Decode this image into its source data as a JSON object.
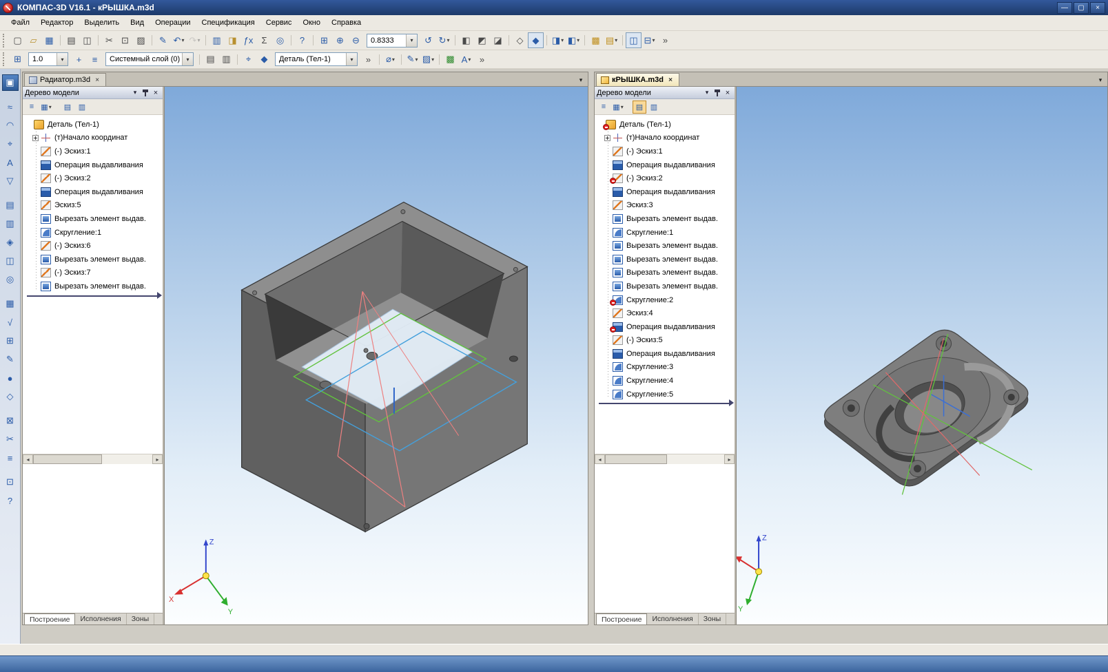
{
  "window": {
    "title": "КОМПАС-3D V16.1 - кРЫШКА.m3d",
    "controls": [
      {
        "name": "minimize-button",
        "glyph": "—"
      },
      {
        "name": "maximize-button",
        "glyph": "▢"
      },
      {
        "name": "close-button",
        "glyph": "×"
      }
    ]
  },
  "menu": {
    "items": [
      "Файл",
      "Редактор",
      "Выделить",
      "Вид",
      "Операции",
      "Спецификация",
      "Сервис",
      "Окно",
      "Справка"
    ]
  },
  "toolbar_main": {
    "zoom_value": "0.8333",
    "buttons_before_zoom": [
      {
        "name": "new-document-button",
        "glyph": "▢",
        "color": "#4a4a4a"
      },
      {
        "name": "open-document-button",
        "glyph": "▱",
        "color": "#b8902f"
      },
      {
        "name": "save-button",
        "glyph": "▦",
        "color": "#2b5ca8"
      },
      {
        "name": "print-button",
        "glyph": "▤",
        "color": "#4a4a4a",
        "grp": true
      },
      {
        "name": "print-preview-button",
        "glyph": "◫",
        "color": "#4a4a4a"
      },
      {
        "name": "cut-button",
        "glyph": "✂",
        "color": "#4a4a4a",
        "grp": true
      },
      {
        "name": "copy-button",
        "glyph": "⊡",
        "color": "#4a4a4a"
      },
      {
        "name": "paste-button",
        "glyph": "▨",
        "color": "#4a4a4a"
      },
      {
        "name": "copy-properties-button",
        "glyph": "✎",
        "color": "#2b5ca8",
        "grp": true
      },
      {
        "name": "undo-button",
        "glyph": "↶",
        "color": "#2b5ca8",
        "dd": true
      },
      {
        "name": "redo-button",
        "glyph": "↷",
        "color": "#9a9a9a",
        "dd": true,
        "dis": true
      },
      {
        "name": "library-manager-button",
        "glyph": "▥",
        "color": "#2b5ca8",
        "grp": true
      },
      {
        "name": "typical-models-button",
        "glyph": "◨",
        "color": "#b8902f"
      },
      {
        "name": "functions-button",
        "glyph": "ƒx",
        "color": "#2b5ca8"
      },
      {
        "name": "variables-button",
        "glyph": "Σ",
        "color": "#4a4a4a"
      },
      {
        "name": "find-button",
        "glyph": "◎",
        "color": "#2b5ca8"
      },
      {
        "name": "context-help-button",
        "glyph": "?",
        "color": "#2b5ca8",
        "grp": true
      },
      {
        "name": "zoom-window-button",
        "glyph": "⊞",
        "color": "#2b5ca8",
        "grp": true
      },
      {
        "name": "zoom-in-button",
        "glyph": "⊕",
        "color": "#2b5ca8"
      },
      {
        "name": "zoom-out-button",
        "glyph": "⊖",
        "color": "#2b5ca8"
      }
    ],
    "buttons_after_zoom": [
      {
        "name": "refresh-view-button",
        "glyph": "↺",
        "color": "#2b5ca8"
      },
      {
        "name": "rotate-view-button",
        "glyph": "↻",
        "color": "#2b5ca8",
        "dd": true
      },
      {
        "name": "orientation-front-button",
        "glyph": "◧",
        "color": "#4a4a4a",
        "grp": true
      },
      {
        "name": "orientation-iso-button",
        "glyph": "◩",
        "color": "#4a4a4a"
      },
      {
        "name": "orientation-top-button",
        "glyph": "◪",
        "color": "#4a4a4a"
      },
      {
        "name": "display-wireframe-button",
        "glyph": "◇",
        "color": "#4a4a4a",
        "grp": true
      },
      {
        "name": "display-shaded-button",
        "glyph": "◆",
        "color": "#2b5ca8",
        "on": true
      },
      {
        "name": "hide-faces-button",
        "glyph": "◨",
        "color": "#2b5ca8",
        "dd": true,
        "grp": true
      },
      {
        "name": "hide-objects-button",
        "glyph": "◧",
        "color": "#2b5ca8",
        "dd": true
      },
      {
        "name": "section-view-button",
        "glyph": "▩",
        "color": "#c09020",
        "grp": true
      },
      {
        "name": "clip-surface-button",
        "glyph": "▤",
        "color": "#c09020",
        "dd": true
      },
      {
        "name": "sketch-mode-button",
        "glyph": "◫",
        "color": "#2b5ca8",
        "on": true,
        "grp": true
      },
      {
        "name": "mass-properties-button",
        "glyph": "⊟",
        "color": "#2b5ca8",
        "dd": true
      },
      {
        "name": "toolbar-options-button",
        "glyph": "»",
        "color": "#4a4a4a"
      }
    ]
  },
  "toolbar_params": {
    "scale_value": "1.0",
    "layer_value": "Системный слой (0)",
    "part_value": "Деталь (Тел-1)",
    "buttons_a": [
      {
        "name": "grid-button",
        "glyph": "⊞",
        "color": "#2b5ca8"
      }
    ],
    "buttons_b": [
      {
        "name": "snap-button",
        "glyph": "+",
        "color": "#2b5ca8"
      },
      {
        "name": "layers-button",
        "glyph": "≡",
        "color": "#2b5ca8"
      }
    ],
    "buttons_c": [
      {
        "name": "sheet-settings-button",
        "glyph": "▤",
        "color": "#4a4a4a",
        "grp": true
      },
      {
        "name": "sheet-add-button",
        "glyph": "▥",
        "color": "#4a4a4a"
      },
      {
        "name": "local-cs-button",
        "glyph": "⌖",
        "color": "#2b5ca8",
        "grp": true
      },
      {
        "name": "current-model-button",
        "glyph": "◆",
        "color": "#2b5ca8"
      }
    ],
    "buttons_d": [
      {
        "name": "params-overflow-button",
        "glyph": "»",
        "color": "#4a4a4a"
      },
      {
        "name": "rounding-button",
        "glyph": "⌀",
        "color": "#2b5ca8",
        "dd": true,
        "grp": true
      },
      {
        "name": "line-style-button",
        "glyph": "✎",
        "color": "#2b5ca8",
        "dd": true,
        "grp": true
      },
      {
        "name": "hatch-button",
        "glyph": "▨",
        "color": "#2b5ca8",
        "dd": true
      },
      {
        "name": "new-body-button",
        "glyph": "▩",
        "color": "#2e8b2e",
        "grp": true
      },
      {
        "name": "dimensions-style-button",
        "glyph": "A",
        "color": "#2b5ca8",
        "dd": true
      },
      {
        "name": "params-more-button",
        "glyph": "»",
        "color": "#4a4a4a"
      }
    ]
  },
  "left_rail": {
    "buttons": [
      {
        "name": "component-panel-button",
        "glyph": "▣",
        "on": true
      },
      {
        "name": "spatial-curves-button",
        "glyph": "≈",
        "grp": true
      },
      {
        "name": "surfaces-button",
        "glyph": "◠"
      },
      {
        "name": "auxiliary-geometry-button",
        "glyph": "⌖"
      },
      {
        "name": "measure-3d-button",
        "glyph": "A"
      },
      {
        "name": "filters-button",
        "glyph": "▽"
      },
      {
        "name": "specification-button",
        "glyph": "▤",
        "grp": true
      },
      {
        "name": "reports-button",
        "glyph": "▥"
      },
      {
        "name": "design-elements-button",
        "glyph": "◈"
      },
      {
        "name": "sheet-metal-button",
        "glyph": "◫"
      },
      {
        "name": "conditional-images-button",
        "glyph": "◎"
      },
      {
        "name": "arrays-button",
        "glyph": "▦",
        "grp": true
      },
      {
        "name": "verify-button",
        "glyph": "√"
      },
      {
        "name": "libraries-button",
        "glyph": "⊞"
      },
      {
        "name": "edit-button",
        "glyph": "✎"
      },
      {
        "name": "circle-button",
        "glyph": "●"
      },
      {
        "name": "polygon-button",
        "glyph": "◇"
      },
      {
        "name": "lock-button",
        "glyph": "⊠",
        "grp": true
      },
      {
        "name": "scissors-button",
        "glyph": "✂"
      },
      {
        "name": "macro-button",
        "glyph": "≡"
      },
      {
        "name": "settings-button",
        "glyph": "⊡",
        "grp": true
      },
      {
        "name": "help-button",
        "glyph": "?"
      }
    ]
  },
  "ui": {
    "panel_header_buttons": [
      {
        "name": "panel-menu-button"
      },
      {
        "name": "panel-pin-button"
      },
      {
        "name": "panel-close-button"
      }
    ]
  },
  "axis": {
    "x": "X",
    "y": "Y",
    "z": "Z"
  },
  "documents": [
    {
      "tab_label": "Радиатор.m3d",
      "active": false,
      "panel": {
        "title": "Дерево модели",
        "toolbar": [
          {
            "name": "tree-structure-button",
            "glyph": "≡"
          },
          {
            "name": "tree-filter-button",
            "glyph": "▦",
            "dd": true
          },
          {
            "name": "model-info-button",
            "glyph": "▤",
            "grp": true
          },
          {
            "name": "extra-window-button",
            "glyph": "▥"
          }
        ],
        "tree": [
          {
            "label": "Деталь (Тел-1)",
            "icon": "part"
          },
          {
            "label": "(т)Начало координат",
            "icon": "origin",
            "exp": true
          },
          {
            "label": "(-) Эскиз:1",
            "icon": "sketch"
          },
          {
            "label": "Операция выдавливания",
            "icon": "extrude"
          },
          {
            "label": "(-) Эскиз:2",
            "icon": "sketch"
          },
          {
            "label": "Операция выдавливания",
            "icon": "extrude"
          },
          {
            "label": "Эскиз:5",
            "icon": "sketch"
          },
          {
            "label": "Вырезать элемент выдав.",
            "icon": "cut"
          },
          {
            "label": "Скругление:1",
            "icon": "fillet"
          },
          {
            "label": "(-) Эскиз:6",
            "icon": "sketch"
          },
          {
            "label": "Вырезать элемент выдав.",
            "icon": "cut"
          },
          {
            "label": "(-) Эскиз:7",
            "icon": "sketch"
          },
          {
            "label": "Вырезать элемент выдав.",
            "icon": "cut"
          }
        ],
        "tabs": [
          {
            "label": "Построение",
            "active": true
          },
          {
            "label": "Исполнения"
          },
          {
            "label": "Зоны"
          }
        ]
      }
    },
    {
      "tab_label": "кРЫШКА.m3d",
      "active": true,
      "panel": {
        "title": "Дерево модели",
        "toolbar": [
          {
            "name": "tree-structure-button",
            "glyph": "≡"
          },
          {
            "name": "tree-filter-button",
            "glyph": "▦",
            "dd": true
          },
          {
            "name": "model-info-button",
            "glyph": "▤",
            "grp": true,
            "on": true
          },
          {
            "name": "extra-window-button",
            "glyph": "▥"
          }
        ],
        "tree": [
          {
            "label": "Деталь (Тел-1)",
            "icon": "part",
            "err": true
          },
          {
            "label": "(т)Начало координат",
            "icon": "origin",
            "exp": true
          },
          {
            "label": "(-) Эскиз:1",
            "icon": "sketch"
          },
          {
            "label": "Операция выдавливания",
            "icon": "extrude"
          },
          {
            "label": "(-) Эскиз:2",
            "icon": "sketch",
            "err": true
          },
          {
            "label": "Операция выдавливания",
            "icon": "extrude"
          },
          {
            "label": "Эскиз:3",
            "icon": "sketch"
          },
          {
            "label": "Вырезать элемент выдав.",
            "icon": "cut"
          },
          {
            "label": "Скругление:1",
            "icon": "fillet"
          },
          {
            "label": "Вырезать элемент выдав.",
            "icon": "cut"
          },
          {
            "label": "Вырезать элемент выдав.",
            "icon": "cut"
          },
          {
            "label": "Вырезать элемент выдав.",
            "icon": "cut"
          },
          {
            "label": "Вырезать элемент выдав.",
            "icon": "cut"
          },
          {
            "label": "Скругление:2",
            "icon": "fillet",
            "err": true
          },
          {
            "label": "Эскиз:4",
            "icon": "sketch"
          },
          {
            "label": "Операция выдавливания",
            "icon": "extrude",
            "err": true
          },
          {
            "label": "(-) Эскиз:5",
            "icon": "sketch"
          },
          {
            "label": "Операция выдавливания",
            "icon": "extrude"
          },
          {
            "label": "Скругление:3",
            "icon": "fillet"
          },
          {
            "label": "Скругление:4",
            "icon": "fillet"
          },
          {
            "label": "Скругление:5",
            "icon": "fillet"
          }
        ],
        "tabs": [
          {
            "label": "Построение",
            "active": true
          },
          {
            "label": "Исполнения"
          },
          {
            "label": "Зоны"
          }
        ]
      }
    }
  ]
}
